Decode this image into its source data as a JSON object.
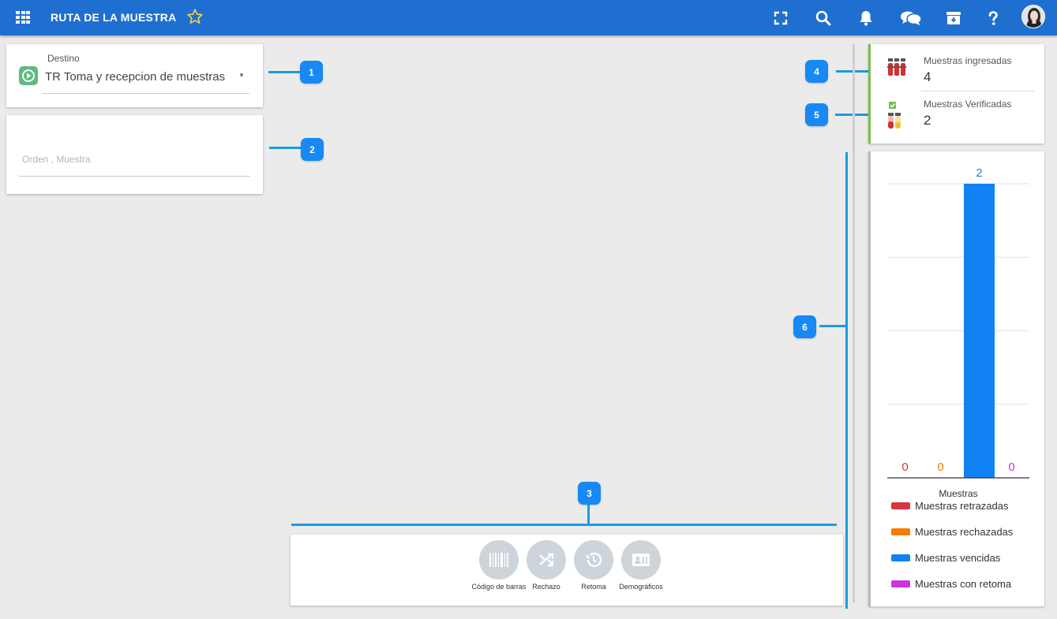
{
  "header": {
    "title": "RUTA DE LA MUESTRA"
  },
  "destino": {
    "label": "Destino",
    "value": "TR Toma y recepcion de muestras"
  },
  "orden": {
    "placeholder": "Orden , Muestra"
  },
  "callouts": [
    "1",
    "2",
    "3",
    "4",
    "5",
    "6"
  ],
  "toolbar": {
    "buttons": [
      {
        "label": "Código de barras",
        "icon": "barcode-icon"
      },
      {
        "label": "Rechazo",
        "icon": "shuffle-icon"
      },
      {
        "label": "Retoma",
        "icon": "history-icon"
      },
      {
        "label": "Demográficos",
        "icon": "id-card-icon"
      }
    ]
  },
  "stats": {
    "ingresadas_label": "Muestras ingresadas",
    "ingresadas_value": "4",
    "verificadas_label": "Muestras Verificadas",
    "verificadas_value": "2"
  },
  "chart_data": {
    "type": "bar",
    "categories": [
      "Muestras retrazadas",
      "Muestras rechazadas",
      "Muestras vencidas",
      "Muestras con retoma"
    ],
    "values": [
      0,
      0,
      2,
      0
    ],
    "colors": [
      "#d9363e",
      "#f57c00",
      "#1082f4",
      "#cc33e0"
    ],
    "xlabel": "Muestras",
    "ylim": [
      0,
      2
    ],
    "grid": true,
    "legend": "bottom"
  }
}
